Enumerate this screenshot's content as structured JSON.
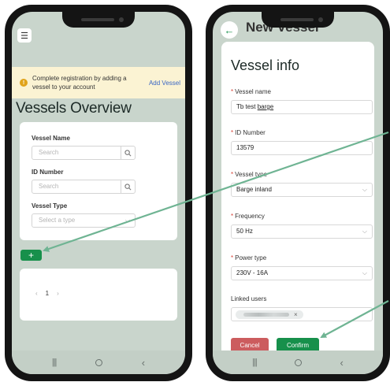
{
  "left": {
    "alert": {
      "message": "Complete registration by adding a vessel to your account",
      "link": "Add Vessel"
    },
    "page_title": "Vessels Overview",
    "filters": {
      "vessel_name_label": "Vessel Name",
      "vessel_name_placeholder": "Search",
      "id_number_label": "ID Number",
      "id_number_placeholder": "Search",
      "vessel_type_label": "Vessel Type",
      "vessel_type_placeholder": "Select a type"
    },
    "add_button": "+",
    "pager": {
      "prev": "‹",
      "page": "1",
      "next": "›"
    }
  },
  "right": {
    "header_title": "New Vessel",
    "form_title": "Vessel info",
    "fields": {
      "vessel_name_label": "Vessel name",
      "vessel_name_value_prefix": "Tb test ",
      "vessel_name_value_underlined": "barge",
      "id_number_label": "ID Number",
      "id_number_value": "13579",
      "vessel_type_label": "Vessel type",
      "vessel_type_value": "Barge inland",
      "frequency_label": "Frequency",
      "frequency_value": "50 Hz",
      "power_type_label": "Power type",
      "power_type_value": "230V - 16A",
      "linked_users_label": "Linked users",
      "linked_user_remove": "×"
    },
    "cancel": "Cancel",
    "confirm": "Confirm"
  },
  "colors": {
    "accent_green": "#17904b",
    "cancel_red": "#cc5c5e",
    "alert_bg": "#fbf3d3",
    "link_blue": "#3a66c4",
    "arrow": "#6fb493",
    "screen_bg": "#c9d5cc"
  },
  "icons": [
    "hamburger-icon",
    "info-icon",
    "search-icon",
    "chevron-down-icon",
    "back-arrow-icon",
    "recents-icon",
    "home-icon",
    "nav-back-icon"
  ]
}
